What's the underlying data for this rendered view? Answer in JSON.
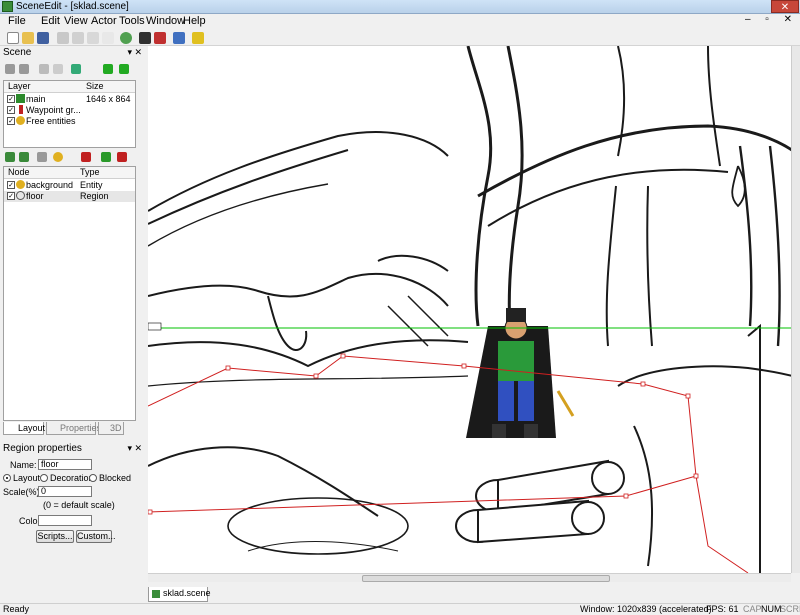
{
  "window": {
    "title": "SceneEdit - [sklad.scene]",
    "close": "✕",
    "mdi": "–  ▫  ✕"
  },
  "menu": [
    "File",
    "Edit",
    "View",
    "Actor",
    "Tools",
    "Window",
    "Help"
  ],
  "toolbar": [
    "new-icon",
    "open-icon",
    "save-icon",
    "cut-icon",
    "copy-icon",
    "paste-icon",
    "delete-icon",
    "refresh-icon",
    "actor-icon",
    "actor-red-icon",
    "undo-icon",
    "help-icon"
  ],
  "scene_panel": {
    "title": "Scene",
    "pin": "▾ ✕",
    "layers": {
      "headers": [
        "Layer",
        "Size"
      ],
      "rows": [
        {
          "name": "main",
          "size": "1646 x 864"
        },
        {
          "name": "Waypoint gr...",
          "size": ""
        },
        {
          "name": "Free entities",
          "size": ""
        }
      ]
    },
    "nodes": {
      "headers": [
        "Node",
        "Type"
      ],
      "rows": [
        {
          "name": "background",
          "type": "Entity"
        },
        {
          "name": "floor",
          "type": "Region"
        }
      ]
    },
    "tabs": [
      "Layout",
      "Properties",
      "3D"
    ]
  },
  "region_props": {
    "title": "Region properties",
    "name_label": "Name:",
    "name_value": "floor",
    "modes": [
      "Layout",
      "Decoration",
      "Blocked"
    ],
    "selected_mode": "Layout",
    "scale_label": "Scale(%):",
    "scale_value": "0",
    "scale_hint": "(0 = default scale)",
    "color_label": "Color:",
    "buttons": [
      "Scripts...",
      "Custom..."
    ]
  },
  "document_tab": "sklad.scene",
  "status": {
    "left": "Ready",
    "window": "Window: 1020x839 (accelerated)",
    "fps": "FPS: 61",
    "caps": "CAP",
    "num": "NUM",
    "scrl": "SCRL"
  },
  "colors": {
    "selection_line": "#00c000",
    "region_line": "#d02020",
    "character_cloak": "#1a1a1a",
    "character_shirt": "#2a9a3a",
    "character_pants": "#3050c0"
  }
}
